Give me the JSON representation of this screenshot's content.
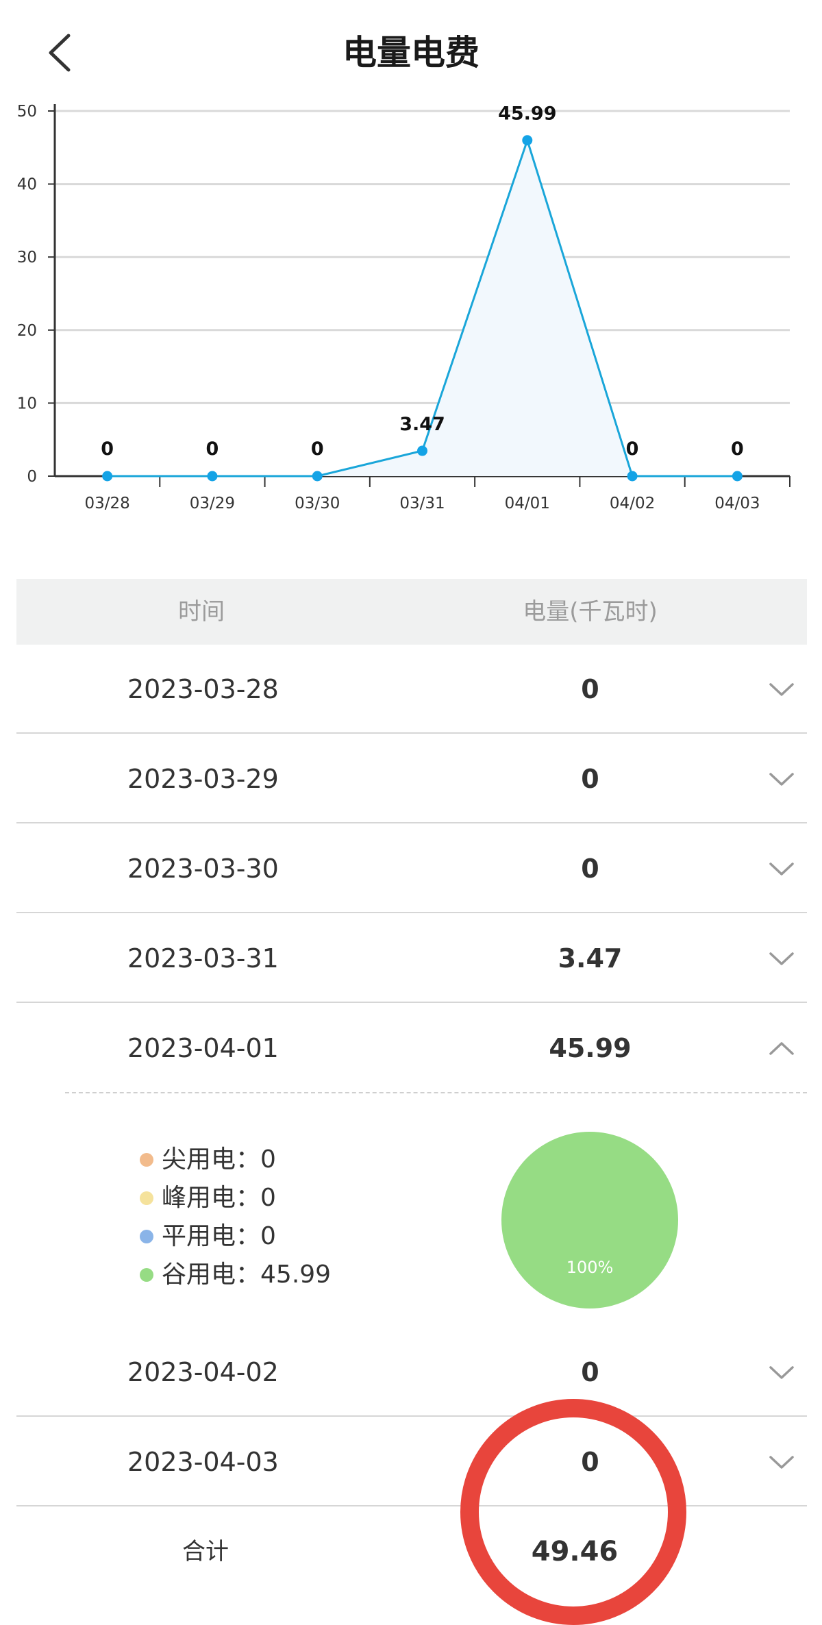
{
  "header": {
    "title": "电量电费"
  },
  "chart_data": {
    "type": "area",
    "categories": [
      "03/28",
      "03/29",
      "03/30",
      "03/31",
      "04/01",
      "04/02",
      "04/03"
    ],
    "values": [
      0,
      0,
      0,
      3.47,
      45.99,
      0,
      0
    ],
    "data_labels": [
      "0",
      "0",
      "0",
      "3.47",
      "45.99",
      "0",
      "0"
    ],
    "y_ticks": [
      0,
      10,
      20,
      30,
      40,
      50
    ],
    "ylim": [
      0,
      50
    ],
    "grid": true,
    "line_color": "#1aa6d9",
    "fill_color": "#f2f8fd",
    "point_color": "#14a3e6"
  },
  "table": {
    "col_time": "时间",
    "col_value": "电量(千瓦时)",
    "rows": [
      {
        "date": "2023-03-28",
        "value": "0"
      },
      {
        "date": "2023-03-29",
        "value": "0"
      },
      {
        "date": "2023-03-30",
        "value": "0"
      },
      {
        "date": "2023-03-31",
        "value": "3.47"
      },
      {
        "date": "2023-04-01",
        "value": "45.99"
      },
      {
        "date": "2023-04-02",
        "value": "0"
      },
      {
        "date": "2023-04-03",
        "value": "0"
      }
    ],
    "expanded_index": 4,
    "total_label": "合计",
    "total_value": "49.46"
  },
  "detail": {
    "legend": [
      {
        "label": "尖用电：",
        "value": "0",
        "color": "#f2bb8c"
      },
      {
        "label": "峰用电：",
        "value": "0",
        "color": "#f5e29c"
      },
      {
        "label": "平用电：",
        "value": "0",
        "color": "#8ab4e8"
      },
      {
        "label": "谷用电：",
        "value": "45.99",
        "color": "#96dc84"
      }
    ],
    "pie_label": "100%",
    "pie_color": "#96dc84"
  },
  "colors": {
    "highlight_ring": "#e8453c"
  }
}
